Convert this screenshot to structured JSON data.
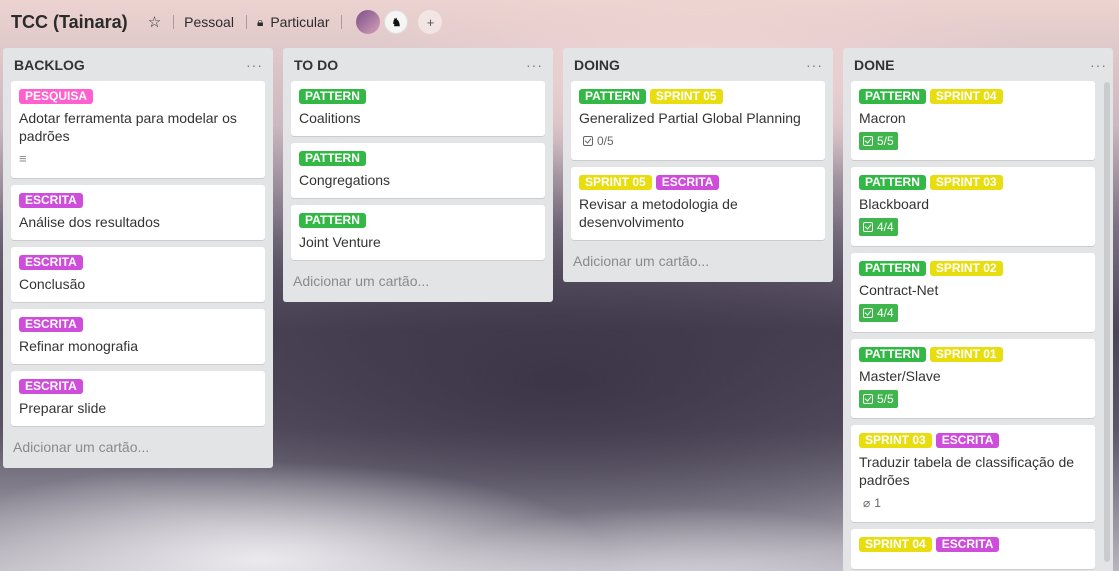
{
  "header": {
    "board_title": "TCC (Tainara)",
    "team": "Pessoal",
    "visibility": "Particular"
  },
  "lists": {
    "backlog": {
      "title": "BACKLOG",
      "add_card": "Adicionar um cartão...",
      "cards": [
        {
          "labels": [
            "PESQUISA"
          ],
          "title": "Adotar ferramenta para modelar os padrões"
        },
        {
          "labels": [
            "ESCRITA"
          ],
          "title": "Análise dos resultados"
        },
        {
          "labels": [
            "ESCRITA"
          ],
          "title": "Conclusão"
        },
        {
          "labels": [
            "ESCRITA"
          ],
          "title": "Refinar monografia"
        },
        {
          "labels": [
            "ESCRITA"
          ],
          "title": "Preparar slide"
        }
      ]
    },
    "todo": {
      "title": "TO DO",
      "add_card": "Adicionar um cartão...",
      "cards": [
        {
          "labels": [
            "PATTERN"
          ],
          "title": "Coalitions"
        },
        {
          "labels": [
            "PATTERN"
          ],
          "title": "Congregations"
        },
        {
          "labels": [
            "PATTERN"
          ],
          "title": "Joint Venture"
        }
      ]
    },
    "doing": {
      "title": "DOING",
      "add_card": "Adicionar um cartão...",
      "cards": [
        {
          "labels": [
            "PATTERN",
            "SPRINT 05"
          ],
          "title": "Generalized Partial Global Planning",
          "checklist": "0/5"
        },
        {
          "labels": [
            "SPRINT 05",
            "ESCRITA"
          ],
          "title": "Revisar a metodologia de desenvolvimento"
        }
      ]
    },
    "done": {
      "title": "DONE",
      "cards": [
        {
          "labels": [
            "PATTERN",
            "SPRINT 04"
          ],
          "title": "Macron",
          "checklist": "5/5"
        },
        {
          "labels": [
            "PATTERN",
            "SPRINT 03"
          ],
          "title": "Blackboard",
          "checklist": "4/4"
        },
        {
          "labels": [
            "PATTERN",
            "SPRINT 02"
          ],
          "title": "Contract-Net",
          "checklist": "4/4"
        },
        {
          "labels": [
            "PATTERN",
            "SPRINT 01"
          ],
          "title": "Master/Slave",
          "checklist": "5/5"
        },
        {
          "labels": [
            "SPRINT 03",
            "ESCRITA"
          ],
          "title": "Traduzir tabela de classificação de padrões",
          "attachments": "1"
        },
        {
          "labels": [
            "SPRINT 04",
            "ESCRITA"
          ],
          "title": ""
        }
      ]
    }
  },
  "icons": {
    "star": "star-icon",
    "lock": "lock-icon",
    "list_menu": "ellipsis-icon",
    "description": "description-icon",
    "checklist": "checklist-icon",
    "attachment": "paperclip-icon",
    "add_member": "add-member-icon"
  },
  "colors": {
    "pesquisa": "#ff5fcf",
    "escrita": "#cf4ddb",
    "pattern": "#33b845",
    "sprint": "#e7dd0f",
    "checklist_complete": "#3fb64b"
  }
}
